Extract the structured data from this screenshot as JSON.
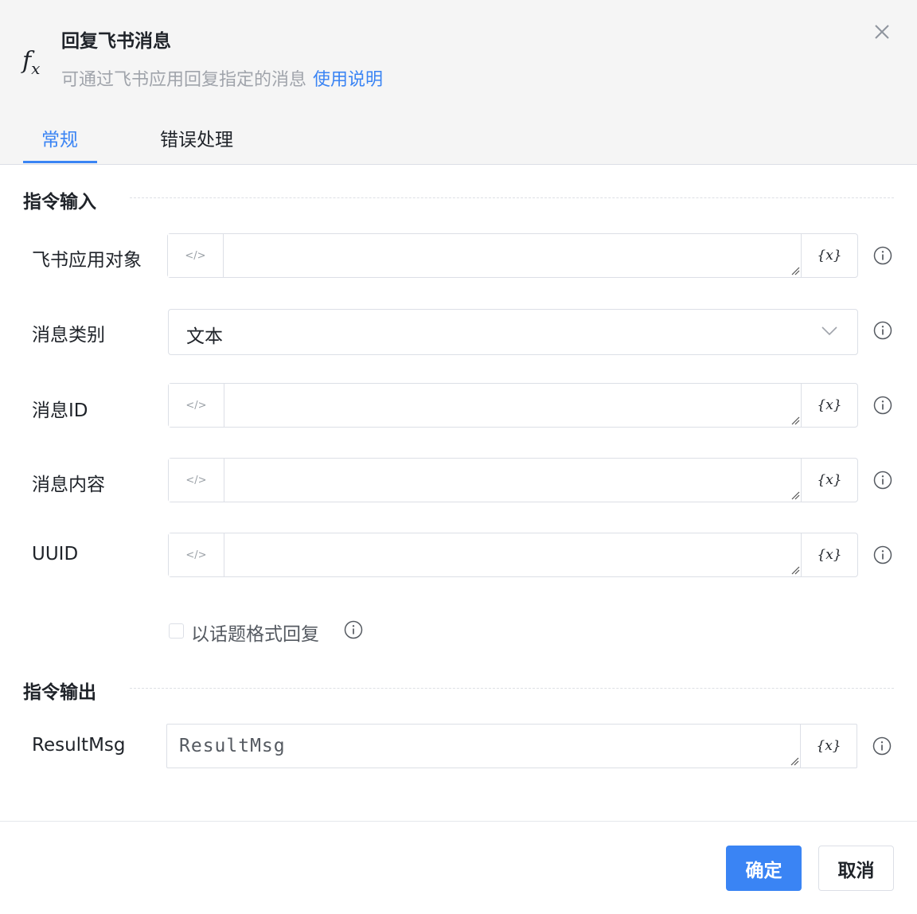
{
  "dialog": {
    "title": "回复飞书消息",
    "description": "可通过飞书应用回复指定的消息",
    "help_link": "使用说明"
  },
  "tabs": [
    {
      "label": "常规",
      "active": true
    },
    {
      "label": "错误处理",
      "active": false
    }
  ],
  "sections": {
    "input_title": "指令输入",
    "output_title": "指令输出"
  },
  "fields": {
    "app_object": {
      "label": "飞书应用对象",
      "value": ""
    },
    "message_type": {
      "label": "消息类别",
      "value": "文本"
    },
    "message_id": {
      "label": "消息ID",
      "value": ""
    },
    "message_content": {
      "label": "消息内容",
      "value": ""
    },
    "uuid": {
      "label": "UUID",
      "value": ""
    },
    "result_msg": {
      "label": "ResultMsg",
      "value": "ResultMsg"
    }
  },
  "checkbox": {
    "label": "以话题格式回复",
    "checked": false
  },
  "variable_button_label": "{x}",
  "code_button_label": "</>",
  "buttons": {
    "confirm": "确定",
    "cancel": "取消"
  },
  "colors": {
    "accent": "#3a84f4",
    "header_bg": "#f5f5f5",
    "border": "#dcdfe6"
  }
}
